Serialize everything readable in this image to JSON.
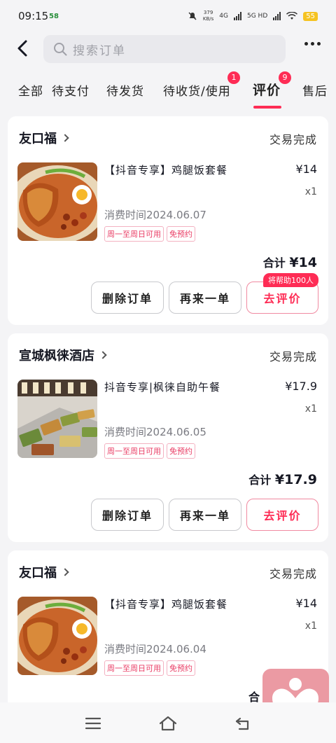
{
  "status_bar": {
    "time": "09:15",
    "badge": "58",
    "speed_value": "379",
    "speed_unit": "KB/s",
    "net1": "4G",
    "net2": "5G HD",
    "battery": "55"
  },
  "header": {
    "search_placeholder": "搜索订单"
  },
  "tabs": [
    {
      "label": "全部"
    },
    {
      "label": "待支付"
    },
    {
      "label": "待发货"
    },
    {
      "label": "待收货/使用",
      "count": "1"
    },
    {
      "label": "评价",
      "count": "9",
      "active": true
    },
    {
      "label": "售后"
    }
  ],
  "orders": [
    {
      "store": "友口福",
      "status": "交易完成",
      "title": "【抖音专享】鸡腿饭套餐",
      "price": "¥14",
      "qty": "x1",
      "consume_time": "消费时间2024.06.07",
      "tags": [
        "周一至周日可用",
        "免预约"
      ],
      "total_label": "合计",
      "total": "¥14",
      "delete_label": "删除订单",
      "again_label": "再来一单",
      "review_label": "去评价",
      "review_tip": "将帮助100人"
    },
    {
      "store": "宣城枫徕酒店",
      "status": "交易完成",
      "title": "抖音专享|枫徕自助午餐",
      "price": "¥17.9",
      "qty": "x1",
      "consume_time": "消费时间2024.06.05",
      "tags": [
        "周一至周日可用",
        "免预约"
      ],
      "total_label": "合计",
      "total": "¥17.9",
      "delete_label": "删除订单",
      "again_label": "再来一单",
      "review_label": "去评价"
    },
    {
      "store": "友口福",
      "status": "交易完成",
      "title": "【抖音专享】鸡腿饭套餐",
      "price": "¥14",
      "qty": "x1",
      "consume_time": "消费时间2024.06.04",
      "tags": [
        "周一至周日可用",
        "免预约"
      ],
      "total_label": "合"
    }
  ],
  "colors": {
    "accent": "#fe2c55",
    "tag_text": "#e93b63",
    "float_button": "#eb9aa3"
  },
  "icons": {
    "back": "chevron-left-icon",
    "search": "search-icon",
    "more": "more-dots-icon",
    "nav_menu": "menu-icon",
    "nav_home": "home-icon",
    "nav_back": "back-arrow-icon",
    "float": "heart-person-icon"
  }
}
